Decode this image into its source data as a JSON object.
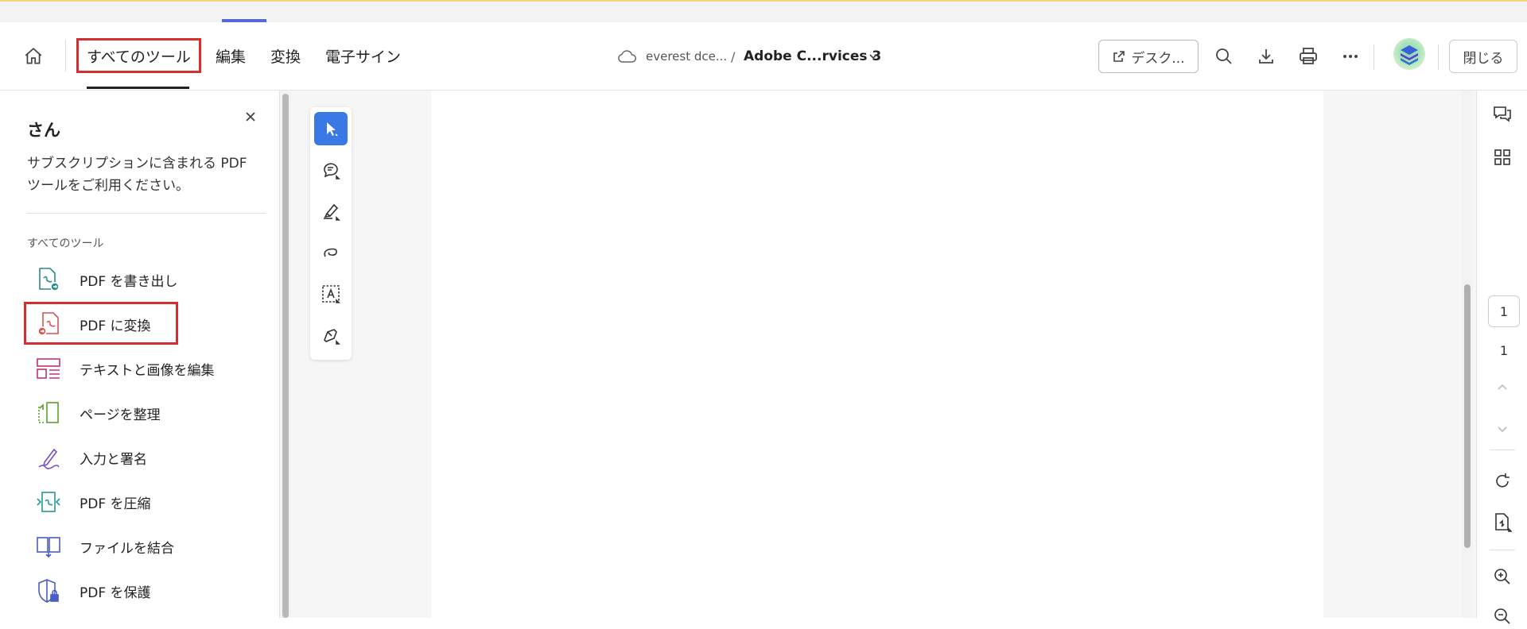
{
  "header": {
    "nav_tabs": [
      "すべてのツール",
      "編集",
      "変換",
      "電子サイン"
    ],
    "breadcrumb_location": "everest dce...",
    "breadcrumb_separator": "/",
    "file_name": "Adobe C...rvices 3",
    "desktop_button": "デスク...",
    "close_button": "閉じる"
  },
  "left_panel": {
    "title": "さん",
    "description": "サブスクリプションに含まれる PDF ツールをご利用ください。",
    "section_label": "すべてのツール",
    "tools": [
      {
        "label": "PDF を書き出し",
        "icon": "export-pdf-icon",
        "color": "#2a8a8a"
      },
      {
        "label": "PDF に変換",
        "icon": "create-pdf-icon",
        "color": "#d9534f"
      },
      {
        "label": "テキストと画像を編集",
        "icon": "edit-pdf-icon",
        "color": "#c2327a"
      },
      {
        "label": "ページを整理",
        "icon": "organize-pages-icon",
        "color": "#5aa02c"
      },
      {
        "label": "入力と署名",
        "icon": "fill-sign-icon",
        "color": "#7b4fc7"
      },
      {
        "label": "PDF を圧縮",
        "icon": "compress-pdf-icon",
        "color": "#1f9aa0"
      },
      {
        "label": "ファイルを結合",
        "icon": "combine-files-icon",
        "color": "#4b5bc4"
      },
      {
        "label": "PDF を保護",
        "icon": "protect-pdf-icon",
        "color": "#4b5bc4"
      }
    ]
  },
  "page_nav": {
    "current_page": "1",
    "total_pages": "1"
  },
  "colors": {
    "accent_blue": "#3a78e6",
    "highlight_red": "#d32f2f",
    "tab_mark": "#5a67d8"
  }
}
